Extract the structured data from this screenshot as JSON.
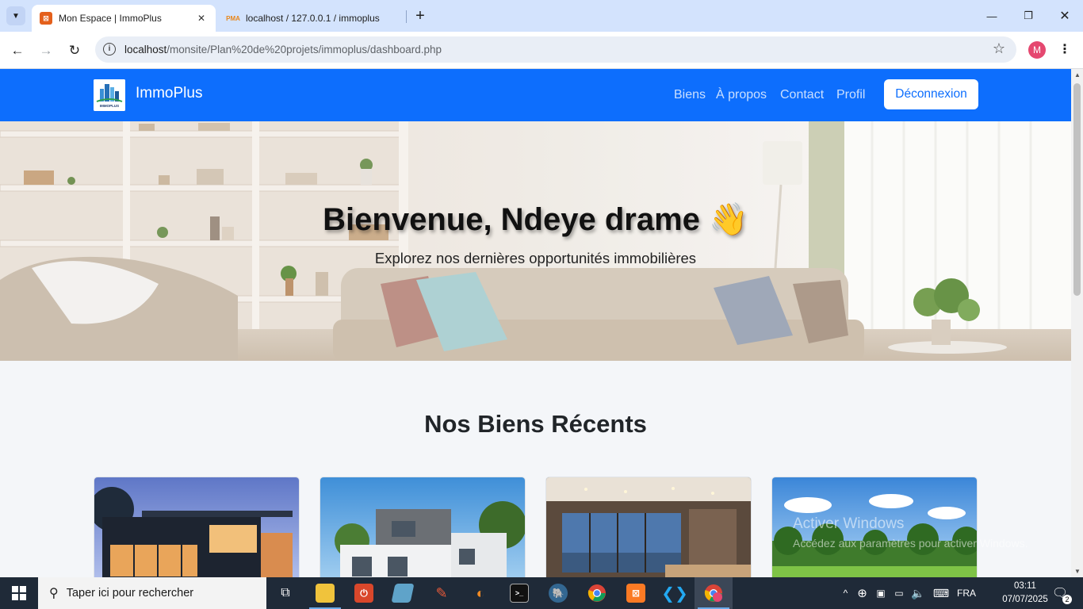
{
  "browser": {
    "tabs": [
      {
        "title": "Mon Espace | ImmoPlus",
        "active": true
      },
      {
        "title": "localhost / 127.0.0.1 / immoplus",
        "active": false
      }
    ],
    "tab_close_glyph": "✕",
    "new_tab_glyph": "+",
    "url_host": "localhost",
    "url_path": "/monsite/Plan%20de%20projets/immoplus/dashboard.php",
    "profile_initial": "M"
  },
  "site": {
    "brand": "ImmoPlus",
    "logo_text": "IMMOPLUS",
    "nav": [
      "Biens",
      "À propos",
      "Contact",
      "Profil"
    ],
    "logout_label": "Déconnexion",
    "accent": "#0d6efd"
  },
  "hero": {
    "title": "Bienvenue, Ndeye drame 👋",
    "subtitle": "Explorez nos dernières opportunités immobilières"
  },
  "section": {
    "title": "Nos Biens Récents"
  },
  "cards": [
    {
      "image": "modern-house-dusk"
    },
    {
      "image": "white-villa-pool"
    },
    {
      "image": "living-room-city-view"
    },
    {
      "image": "green-park-land"
    }
  ],
  "watermark": {
    "line1": "Activer Windows",
    "line2": "Accédez aux paramètres pour activer Windows."
  },
  "taskbar": {
    "search_placeholder": "Taper ici pour rechercher",
    "language": "FRA",
    "time": "03:11",
    "date": "07/07/2025",
    "notification_count": "2"
  }
}
